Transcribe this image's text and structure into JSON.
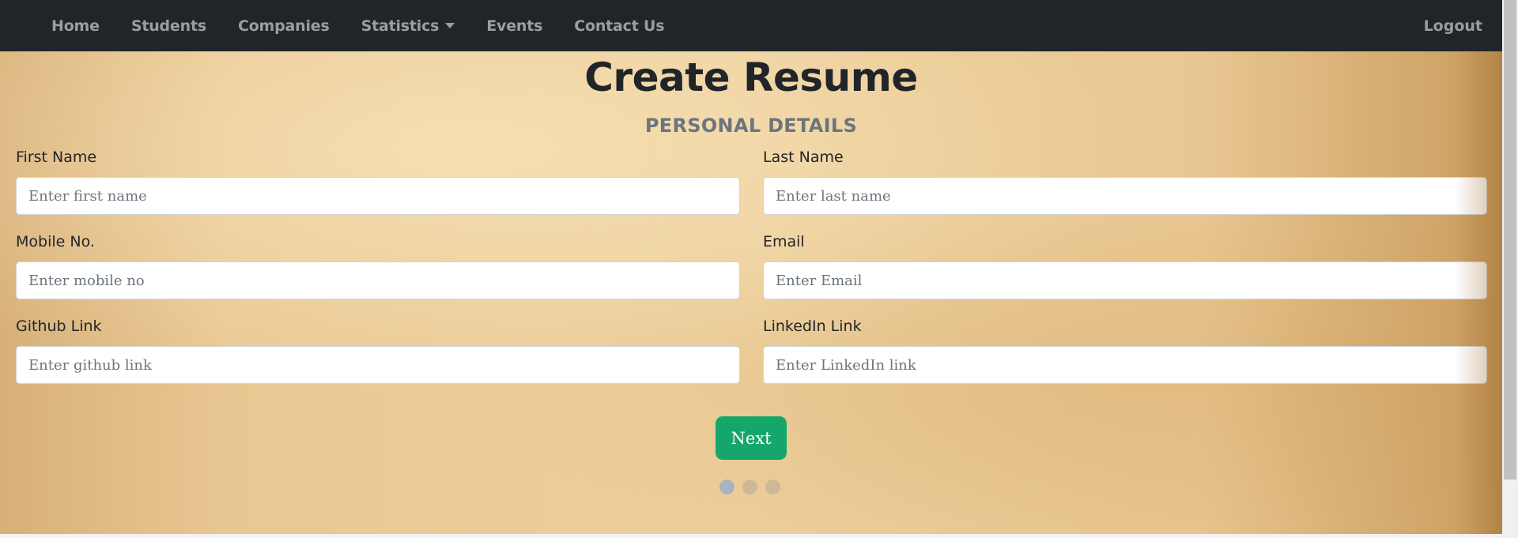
{
  "nav": {
    "links": [
      "Home",
      "Students",
      "Companies",
      "Statistics",
      "Events",
      "Contact Us"
    ],
    "logout": "Logout"
  },
  "page": {
    "title": "Create Resume",
    "section": "PERSONAL DETAILS"
  },
  "form": {
    "first_name": {
      "label": "First Name",
      "placeholder": "Enter first name"
    },
    "last_name": {
      "label": "Last Name",
      "placeholder": "Enter last name"
    },
    "mobile": {
      "label": "Mobile No.",
      "placeholder": "Enter mobile no"
    },
    "email": {
      "label": "Email",
      "placeholder": "Enter Email"
    },
    "github": {
      "label": "Github Link",
      "placeholder": "Enter github link"
    },
    "linkedin": {
      "label": "LinkedIn Link",
      "placeholder": "Enter LinkedIn link"
    }
  },
  "actions": {
    "next": "Next"
  },
  "steps": {
    "total": 3,
    "current": 1
  }
}
